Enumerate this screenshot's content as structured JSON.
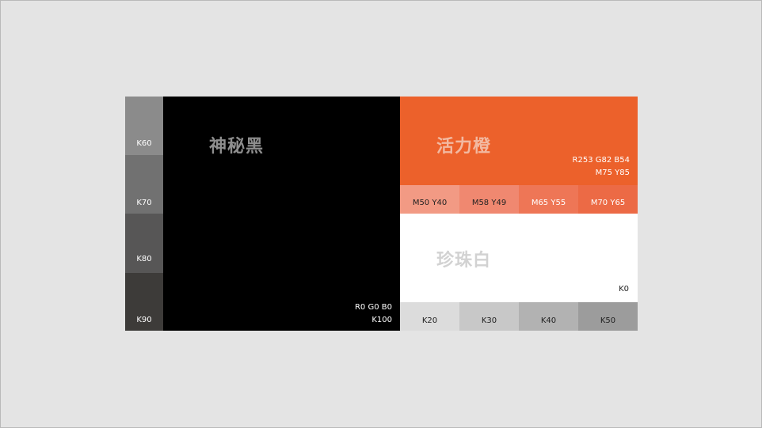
{
  "colors": {
    "background": "#e4e4e4",
    "k60": "#8b8b8b",
    "k70": "#717171",
    "k80": "#575656",
    "k90": "#3d3b39",
    "black": "#000000",
    "orange": "#ec612b",
    "m50y40": "#f29a84",
    "m58y49": "#f08870",
    "m65y55": "#ee7656",
    "m70y65": "#ec6a45",
    "white": "#ffffff",
    "k20": "#dcdcdc",
    "k30": "#c8c8c8",
    "k40": "#b2b2b2",
    "k50": "#9c9c9c"
  },
  "grays": {
    "k60": "K60",
    "k70": "K70",
    "k80": "K80",
    "k90": "K90"
  },
  "black": {
    "name": "神秘黑",
    "rgb": "R0 G0 B0",
    "cmyk": "K100"
  },
  "orange": {
    "name": "活力橙",
    "rgb": "R253 G82 B54",
    "cmyk": "M75 Y85",
    "tints": [
      "M50 Y40",
      "M58 Y49",
      "M65 Y55",
      "M70 Y65"
    ]
  },
  "white": {
    "name": "珍珠白",
    "cmyk": "K0",
    "grays": [
      "K20",
      "K30",
      "K40",
      "K50"
    ]
  }
}
